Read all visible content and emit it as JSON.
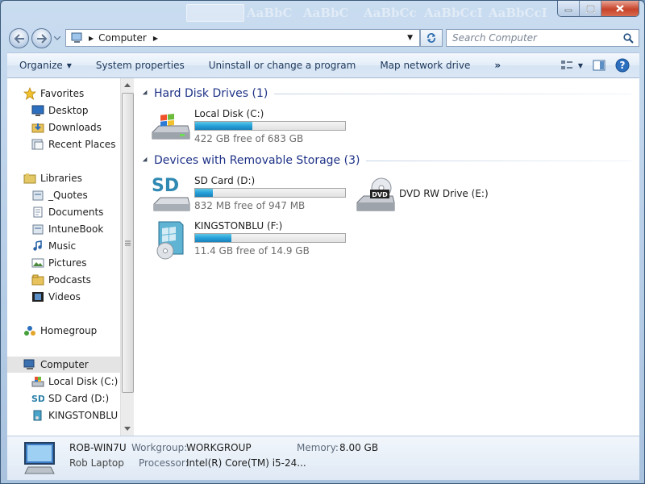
{
  "window": {
    "title_ghosts": [
      "AaBbC",
      "AaBbC",
      "AaBbCc",
      "AaBbCcI",
      "AaBbCcI"
    ]
  },
  "address": {
    "root": "Computer",
    "search_placeholder": "Search Computer"
  },
  "toolbar": {
    "organize": "Organize",
    "system_properties": "System properties",
    "uninstall": "Uninstall or change a program",
    "map_drive": "Map network drive",
    "more": "»"
  },
  "sidebar": {
    "favorites": {
      "label": "Favorites",
      "items": [
        {
          "label": "Desktop",
          "icon": "desktop-icon"
        },
        {
          "label": "Downloads",
          "icon": "downloads-folder-icon"
        },
        {
          "label": "Recent Places",
          "icon": "recent-places-icon"
        }
      ]
    },
    "libraries": {
      "label": "Libraries",
      "items": [
        {
          "label": "_Quotes",
          "icon": "library-icon"
        },
        {
          "label": "Documents",
          "icon": "documents-icon"
        },
        {
          "label": "IntuneBook",
          "icon": "library-icon"
        },
        {
          "label": "Music",
          "icon": "music-icon"
        },
        {
          "label": "Pictures",
          "icon": "pictures-icon"
        },
        {
          "label": "Podcasts",
          "icon": "folder-icon"
        },
        {
          "label": "Videos",
          "icon": "videos-icon"
        }
      ]
    },
    "homegroup": "Homegroup",
    "computer": {
      "label": "Computer",
      "items": [
        {
          "label": "Local Disk (C:)",
          "icon": "hard-disk-icon"
        },
        {
          "label": "SD Card (D:)",
          "icon": "sd-card-icon"
        },
        {
          "label": "KINGSTONBLU (F",
          "icon": "usb-drive-icon"
        }
      ]
    }
  },
  "groups": {
    "hdd": {
      "title": "Hard Disk Drives (1)"
    },
    "removable": {
      "title": "Devices with Removable Storage (3)"
    }
  },
  "drives": {
    "c": {
      "name": "Local Disk (C:)",
      "free": "422 GB free of 683 GB",
      "used_fraction": 0.38
    },
    "d": {
      "name": "SD Card (D:)",
      "free": "832 MB free of 947 MB",
      "used_fraction": 0.12,
      "icon_text": "SD"
    },
    "e": {
      "name": "DVD RW Drive (E:)",
      "icon_text": "DVD"
    },
    "f": {
      "name": "KINGSTONBLU (F:)",
      "free": "11.4 GB free of 14.9 GB",
      "used_fraction": 0.24
    }
  },
  "details": {
    "computer_name": "ROB-WIN7U",
    "description": "Rob Laptop",
    "workgroup_label": "Workgroup:",
    "workgroup": "WORKGROUP",
    "memory_label": "Memory:",
    "memory": "8.00 GB",
    "processor_label": "Processor:",
    "processor": "Intel(R) Core(TM) i5-24..."
  },
  "colors": {
    "accent": "#26a0da",
    "group_title": "#1e3287",
    "selection": "#e4e4e4"
  }
}
